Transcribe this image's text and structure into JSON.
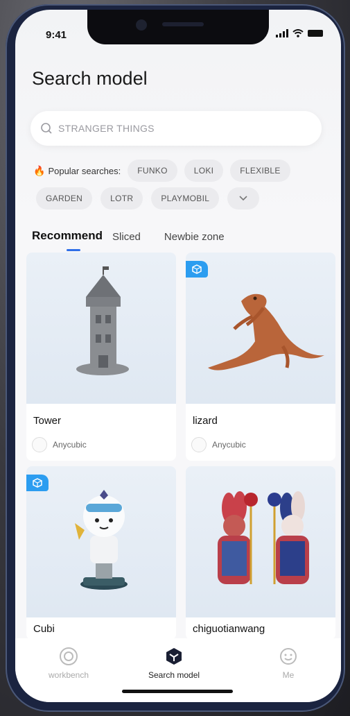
{
  "status_bar": {
    "time": "9:41"
  },
  "page": {
    "title": "Search model"
  },
  "search": {
    "placeholder": "STRANGER THINGS"
  },
  "popular": {
    "label": "Popular searches:",
    "chips": [
      "FUNKO",
      "LOKI",
      "FLEXIBLE",
      "GARDEN",
      "LOTR",
      "PLAYMOBIL"
    ]
  },
  "tabs": [
    "Recommend",
    "Sliced",
    "Newbie zone"
  ],
  "models": [
    {
      "title": "Tower",
      "author": "Anycubic",
      "badge": false
    },
    {
      "title": "lizard",
      "author": "Anycubic",
      "badge": true
    },
    {
      "title": "Cubi",
      "author": "",
      "badge": true
    },
    {
      "title": "chiguotianwang",
      "author": "",
      "badge": false
    }
  ],
  "bottom_nav": [
    {
      "label": "workbench",
      "icon": "workbench-icon"
    },
    {
      "label": "Search model",
      "icon": "search-model-icon"
    },
    {
      "label": "Me",
      "icon": "me-icon"
    }
  ],
  "colors": {
    "accent": "#2f6fe8",
    "badge": "#2c9df0",
    "fire": "#ff6a2a"
  }
}
